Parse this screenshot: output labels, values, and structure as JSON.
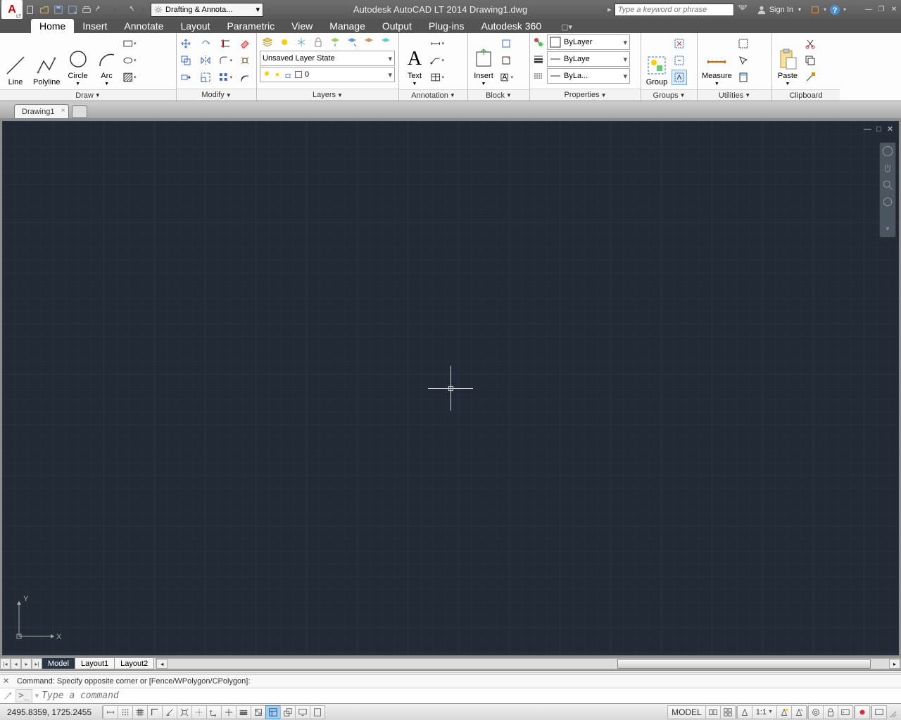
{
  "titlebar": {
    "workspace": "Drafting & Annota...",
    "app_title": "Autodesk AutoCAD LT 2014   Drawing1.dwg",
    "search_placeholder": "Type a keyword or phrase",
    "sign_in": "Sign In"
  },
  "menubar": {
    "tabs": [
      "Home",
      "Insert",
      "Annotate",
      "Layout",
      "Parametric",
      "View",
      "Manage",
      "Output",
      "Plug-ins",
      "Autodesk 360"
    ],
    "active": 0
  },
  "ribbon": {
    "draw": {
      "title": "Draw",
      "big": [
        "Line",
        "Polyline",
        "Circle",
        "Arc"
      ]
    },
    "modify": {
      "title": "Modify"
    },
    "layers": {
      "title": "Layers",
      "state_dd": "Unsaved Layer State",
      "layer_dd": "0"
    },
    "annotation": {
      "title": "Annotation",
      "big": "Text"
    },
    "block": {
      "title": "Block",
      "big": "Insert"
    },
    "properties": {
      "title": "Properties",
      "color": "ByLayer",
      "lw": "ByLaye",
      "lt": "ByLa..."
    },
    "groups": {
      "title": "Groups",
      "big": "Group"
    },
    "utilities": {
      "title": "Utilities",
      "big": "Measure"
    },
    "clipboard": {
      "title": "Clipboard",
      "big": "Paste"
    }
  },
  "doctab": {
    "name": "Drawing1"
  },
  "ucs": {
    "y": "Y",
    "x": "X"
  },
  "layout_tabs": [
    "Model",
    "Layout1",
    "Layout2"
  ],
  "command": {
    "history": "Command: Specify opposite corner or [Fence/WPolygon/CPolygon]:",
    "prompt": ">_",
    "placeholder": "Type a command"
  },
  "status": {
    "coords": "2495.8359, 1725.2455",
    "model": "MODEL",
    "scale": "1:1"
  }
}
